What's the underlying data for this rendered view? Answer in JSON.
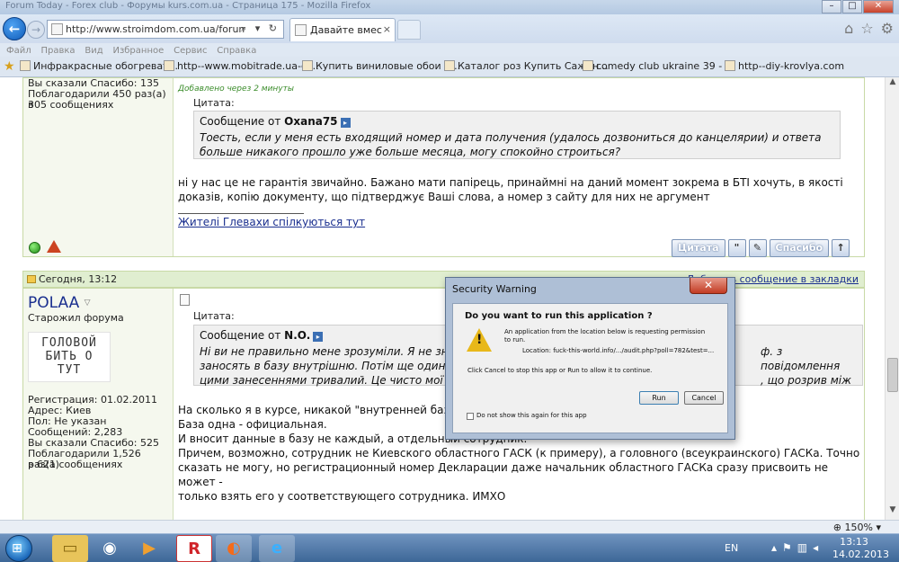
{
  "window": {
    "title": "Forum Today - Forex club - Форумы kurs.com.ua - Страница 175 - Mozilla Firefox",
    "minimize": "–",
    "maximize": "□",
    "close": "✕"
  },
  "nav": {
    "back": "←",
    "forward": "→",
    "url": "http://www.stroimdom.com.ua/forum/shc",
    "addr_icons": "⌕ ▾ ↻",
    "tab_label": "Давайте вместе...",
    "tab_close": "×",
    "right_icons": [
      "⌂",
      "☆",
      "⚙"
    ]
  },
  "menu": [
    "Файл",
    "Правка",
    "Вид",
    "Избранное",
    "Сервис",
    "Справка"
  ],
  "favorites": [
    "Инфракрасные обогреват...",
    "http--www.mobitrade.ua-cl...",
    "Купить виниловые обои Z...",
    "Каталог роз Купить Сажен...",
    "comedy club ukraine 39 - ...",
    "http--diy-krovlya.com"
  ],
  "post1": {
    "side": {
      "thanks_given": "Вы сказали Спасибо: 135",
      "thanked_line1": "Поблагодарили 450 раз(а) в",
      "thanked_line2": "305 сообщениях"
    },
    "added": "Добавлено через 2 минуты",
    "quote_label": "Цитата:",
    "quote_from_prefix": "Сообщение от",
    "quote_author": "Oxana75",
    "quote_line1": "Тоесть, если у меня есть входящий номер и дата получения (удалось дозвониться до канцелярии) и ответа",
    "quote_line2": "больше никакого прошло уже больше месяца, могу спокойно строиться?",
    "reply_line1": "ні у нас це не гарантія звичайно. Бажано мати папірець, принаймні на даний момент зокрема в БТІ хочуть, в якості",
    "reply_line2": "доказів, копію документу, що підтверджує Ваші слова, а номер з сайту для них не аргумент",
    "signature": "Жителі Глевахи спілкуються тут",
    "btn_quote": "Цитата",
    "btn_thanks": "Спасибо"
  },
  "post2": {
    "date": "Сегодня, 13:12",
    "bookmark": "Добавить сообщение в закладки",
    "username": "POLAA",
    "rank": "Старожил форума",
    "avatar_lines": [
      "ГОЛОВОЙ",
      "БИТЬ О",
      "ТУТ"
    ],
    "side": {
      "registered": "Регистрация: 01.02.2011",
      "address": "Адрес: Киев",
      "gender": "Пол: Не указан",
      "posts": "Сообщений: 2,283",
      "thanks_given": "Вы сказали Спасибо: 525",
      "thanked_line1": "Поблагодарили 1,526 раз(а)",
      "thanked_line2": "в 621 сообщениях"
    },
    "quote_label": "Цитата:",
    "quote_from_prefix": "Сообщение от",
    "quote_author": "N.O.",
    "quote_line1": "Ні ви не правильно мене зрозуміли. Я не зн",
    "quote_line1_end": "ф. з повідомлення",
    "quote_line2": "заносять в базу внутрішню. Потім ще один к",
    "quote_line2_end": ", що розрив між",
    "quote_line3": "цими занесеннями тривалий. Це чисто мої з",
    "reply_line1": "На сколько я в курсе, никакой \"внутренней базы",
    "reply_line2": "База одна - официальная.",
    "reply_line3": "И вносит данные в базу не каждый, а отдельный сотрудник.",
    "reply_line4": "Причем, возможно, сотрудник не Киевского областного ГАСК (к примеру), а головного (всеукраинского) ГАСКа. Точно",
    "reply_line5": "сказать не могу, но регистрационный номер Декларации даже начальник областного ГАСКа сразу присвоить не может -",
    "reply_line6": "только взять его у соответствующего сотрудника. ИМХО"
  },
  "dialog": {
    "title": "Security Warning",
    "close": "✕",
    "question": "Do you want to run this application ?",
    "warning": "An application from the location below is requesting permission to run.",
    "location": "Location:  fuck-this-world.info/.../audit.php?poll=782&test=...",
    "hint": "Click Cancel to stop this app or Run to allow it to continue.",
    "run": "Run",
    "cancel": "Cancel",
    "checkbox": "Do not show this again for this app"
  },
  "status": {
    "zoom": "150%"
  },
  "taskbar": {
    "lang": "EN",
    "time": "13:13",
    "date": "14.02.2013"
  }
}
